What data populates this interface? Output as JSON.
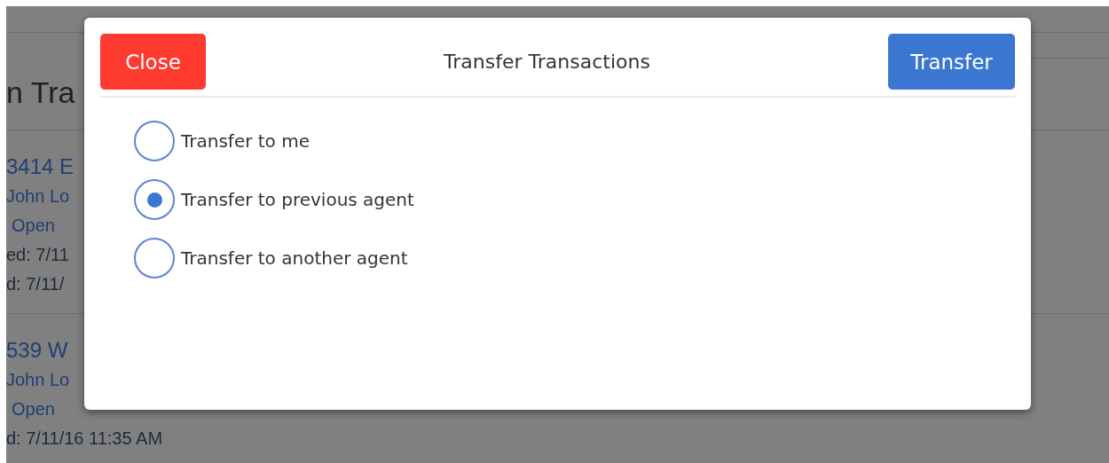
{
  "background": {
    "title": "n Tra",
    "items": [
      {
        "lines": [
          "3414 E",
          "John Lo",
          "Open",
          "ed: 7/11",
          "d: 7/11/"
        ]
      },
      {
        "lines": [
          "539 W",
          "John Lo",
          "Open",
          "d: 7/11/16 11:35 AM"
        ]
      }
    ]
  },
  "dialog": {
    "title": "Transfer Transactions",
    "close_button": "Close",
    "transfer_button": "Transfer",
    "options": [
      {
        "label": "Transfer to me",
        "selected": false
      },
      {
        "label": "Transfer to previous agent",
        "selected": true
      },
      {
        "label": "Transfer to another agent",
        "selected": false
      }
    ]
  }
}
